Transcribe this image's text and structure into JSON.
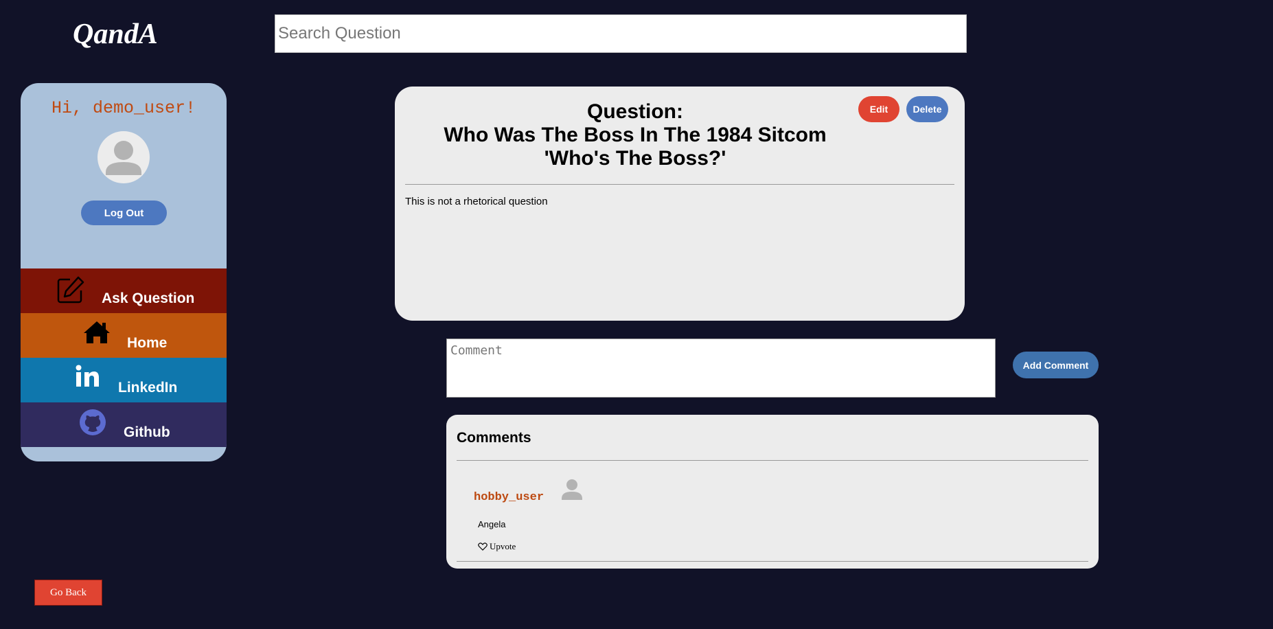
{
  "header": {
    "logo": "QandA",
    "search_placeholder": "Search Question"
  },
  "sidebar": {
    "greeting": "Hi, demo_user!",
    "logout_label": "Log Out",
    "nav": [
      {
        "label": "Ask Question",
        "icon": "pencil-square-icon",
        "color": "#7e1406"
      },
      {
        "label": "Home",
        "icon": "home-icon",
        "color": "#bf560d"
      },
      {
        "label": "LinkedIn",
        "icon": "linkedin-icon",
        "color": "#0f77ad"
      },
      {
        "label": "Github",
        "icon": "github-icon",
        "color": "#302b5e"
      }
    ]
  },
  "question": {
    "title_prefix": "Question:",
    "title": "Who Was The Boss In The 1984 Sitcom 'Who's The Boss?'",
    "body": "This is not a rhetorical question",
    "edit_label": "Edit",
    "delete_label": "Delete"
  },
  "comment_form": {
    "placeholder": "Comment",
    "submit_label": "Add Comment"
  },
  "comments": {
    "heading": "Comments",
    "items": [
      {
        "user": "hobby_user",
        "text": "Angela",
        "upvote_label": "Upvote"
      }
    ]
  },
  "footer": {
    "go_back_label": "Go Back"
  },
  "colors": {
    "background": "#111228",
    "sidebar": "#aac1da",
    "accent_red": "#e04432",
    "accent_blue": "#4d78c0",
    "username": "#bd4a12"
  }
}
